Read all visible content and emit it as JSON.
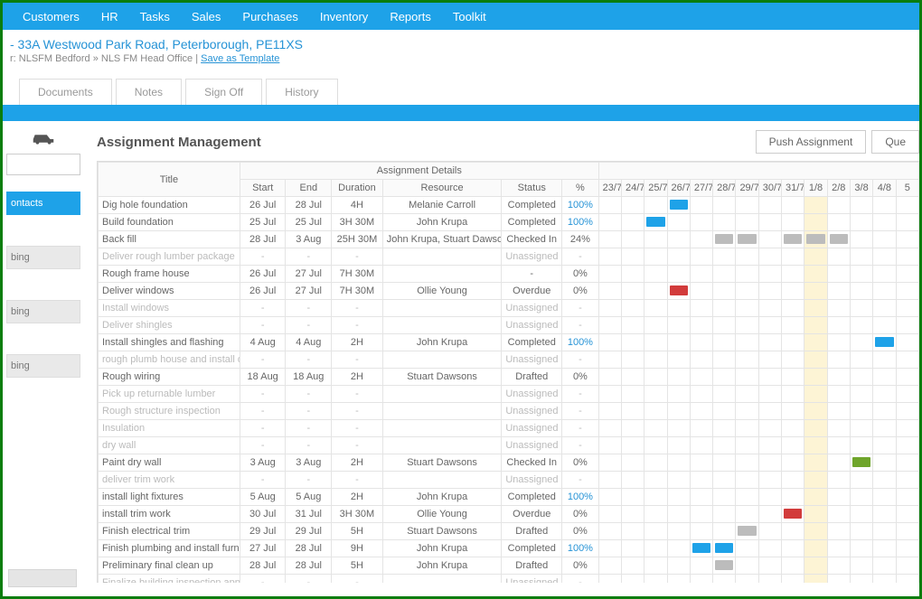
{
  "nav": [
    "Customers",
    "HR",
    "Tasks",
    "Sales",
    "Purchases",
    "Inventory",
    "Reports",
    "Toolkit"
  ],
  "header": {
    "address": "- 33A Westwood Park Road, Peterborough, PE11XS",
    "sub_prefix": "r: NLSFM Bedford » NLS FM Head Office | ",
    "save_link": "Save as Template"
  },
  "tabs": [
    "Documents",
    "Notes",
    "Sign Off",
    "History"
  ],
  "sidebar": {
    "contacts": "ontacts",
    "item1": "bing",
    "item2": "bing",
    "item3": "bing"
  },
  "main": {
    "title": "Assignment Management",
    "push_btn": "Push Assignment",
    "queue_btn": "Que"
  },
  "table": {
    "group_header": "Assignment Details",
    "cols": {
      "title": "Title",
      "start": "Start",
      "end": "End",
      "duration": "Duration",
      "resource": "Resource",
      "status": "Status",
      "pct": "%"
    },
    "dates": [
      "23/7",
      "24/7",
      "25/7",
      "26/7",
      "27/7",
      "28/7",
      "29/7",
      "30/7",
      "31/7",
      "1/8",
      "2/8",
      "3/8",
      "4/8",
      "5"
    ]
  },
  "rows": [
    {
      "title": "Dig hole foundation",
      "start": "26 Jul",
      "end": "28 Jul",
      "dur": "4H",
      "res": "Melanie Carroll",
      "status": "Completed",
      "pct": "100%",
      "bars": [
        {
          "col": 3,
          "span": 1,
          "color": "blue"
        }
      ]
    },
    {
      "title": "Build foundation",
      "start": "25 Jul",
      "end": "25 Jul",
      "dur": "3H 30M",
      "res": "John Krupa",
      "status": "Completed",
      "pct": "100%",
      "bars": [
        {
          "col": 2,
          "span": 1,
          "color": "blue"
        }
      ]
    },
    {
      "title": "Back fill",
      "start": "28 Jul",
      "end": "3 Aug",
      "dur": "25H 30M",
      "res": "John Krupa, Stuart Dawsons",
      "status": "Checked In",
      "pct": "24%",
      "bars": [
        {
          "col": 5,
          "span": 1,
          "color": "gray"
        },
        {
          "col": 6,
          "span": 1,
          "color": "gray"
        },
        {
          "col": 8,
          "span": 1,
          "color": "gray"
        },
        {
          "col": 9,
          "span": 1,
          "color": "gray"
        },
        {
          "col": 10,
          "span": 1,
          "color": "gray"
        }
      ]
    },
    {
      "title": "Deliver rough lumber package",
      "start": "-",
      "end": "-",
      "dur": "-",
      "res": "",
      "status": "Unassigned",
      "pct": "-",
      "muted": true,
      "bars": []
    },
    {
      "title": "Rough frame house",
      "start": "26 Jul",
      "end": "27 Jul",
      "dur": "7H 30M",
      "res": "",
      "status": "-",
      "pct": "0%",
      "bars": []
    },
    {
      "title": "Deliver windows",
      "start": "26 Jul",
      "end": "27 Jul",
      "dur": "7H 30M",
      "res": "Ollie Young",
      "status": "Overdue",
      "pct": "0%",
      "bars": [
        {
          "col": 3,
          "span": 1,
          "color": "red"
        }
      ]
    },
    {
      "title": "Install windows",
      "start": "-",
      "end": "-",
      "dur": "-",
      "res": "",
      "status": "Unassigned",
      "pct": "-",
      "muted": true,
      "bars": []
    },
    {
      "title": "Deliver shingles",
      "start": "-",
      "end": "-",
      "dur": "-",
      "res": "",
      "status": "Unassigned",
      "pct": "-",
      "muted": true,
      "bars": []
    },
    {
      "title": "Install shingles and flashing",
      "start": "4 Aug",
      "end": "4 Aug",
      "dur": "2H",
      "res": "John Krupa",
      "status": "Completed",
      "pct": "100%",
      "bars": [
        {
          "col": 12,
          "span": 1,
          "color": "blue"
        }
      ]
    },
    {
      "title": "rough plumb house and install duct",
      "start": "-",
      "end": "-",
      "dur": "-",
      "res": "",
      "status": "Unassigned",
      "pct": "-",
      "muted": true,
      "bars": []
    },
    {
      "title": "Rough wiring",
      "start": "18 Aug",
      "end": "18 Aug",
      "dur": "2H",
      "res": "Stuart Dawsons",
      "status": "Drafted",
      "pct": "0%",
      "bars": []
    },
    {
      "title": "Pick up returnable lumber",
      "start": "-",
      "end": "-",
      "dur": "-",
      "res": "",
      "status": "Unassigned",
      "pct": "-",
      "muted": true,
      "bars": []
    },
    {
      "title": "Rough structure inspection",
      "start": "-",
      "end": "-",
      "dur": "-",
      "res": "",
      "status": "Unassigned",
      "pct": "-",
      "muted": true,
      "bars": []
    },
    {
      "title": "Insulation",
      "start": "-",
      "end": "-",
      "dur": "-",
      "res": "",
      "status": "Unassigned",
      "pct": "-",
      "muted": true,
      "bars": []
    },
    {
      "title": "dry wall",
      "start": "-",
      "end": "-",
      "dur": "-",
      "res": "",
      "status": "Unassigned",
      "pct": "-",
      "muted": true,
      "bars": []
    },
    {
      "title": "Paint dry wall",
      "start": "3 Aug",
      "end": "3 Aug",
      "dur": "2H",
      "res": "Stuart Dawsons",
      "status": "Checked In",
      "pct": "0%",
      "bars": [
        {
          "col": 11,
          "span": 1,
          "color": "green"
        }
      ]
    },
    {
      "title": "deliver trim work",
      "start": "-",
      "end": "-",
      "dur": "-",
      "res": "",
      "status": "Unassigned",
      "pct": "-",
      "muted": true,
      "bars": []
    },
    {
      "title": "install light fixtures",
      "start": "5 Aug",
      "end": "5 Aug",
      "dur": "2H",
      "res": "John Krupa",
      "status": "Completed",
      "pct": "100%",
      "bars": []
    },
    {
      "title": "install trim work",
      "start": "30 Jul",
      "end": "31 Jul",
      "dur": "3H 30M",
      "res": "Ollie Young",
      "status": "Overdue",
      "pct": "0%",
      "bars": [
        {
          "col": 8,
          "span": 1,
          "color": "red"
        }
      ]
    },
    {
      "title": "Finish electrical trim",
      "start": "29 Jul",
      "end": "29 Jul",
      "dur": "5H",
      "res": "Stuart Dawsons",
      "status": "Drafted",
      "pct": "0%",
      "bars": [
        {
          "col": 6,
          "span": 1,
          "color": "gray"
        }
      ]
    },
    {
      "title": "Finish plumbing and install furnace",
      "start": "27 Jul",
      "end": "28 Jul",
      "dur": "9H",
      "res": "John Krupa",
      "status": "Completed",
      "pct": "100%",
      "bars": [
        {
          "col": 4,
          "span": 1,
          "color": "blue"
        },
        {
          "col": 5,
          "span": 1,
          "color": "blue"
        }
      ]
    },
    {
      "title": "Preliminary final clean up",
      "start": "28 Jul",
      "end": "28 Jul",
      "dur": "5H",
      "res": "John Krupa",
      "status": "Drafted",
      "pct": "0%",
      "bars": [
        {
          "col": 5,
          "span": 1,
          "color": "gray"
        }
      ]
    },
    {
      "title": "Finalize building inspection approva",
      "start": "-",
      "end": "-",
      "dur": "-",
      "res": "",
      "status": "Unassigned",
      "pct": "-",
      "muted": true,
      "bars": []
    }
  ]
}
